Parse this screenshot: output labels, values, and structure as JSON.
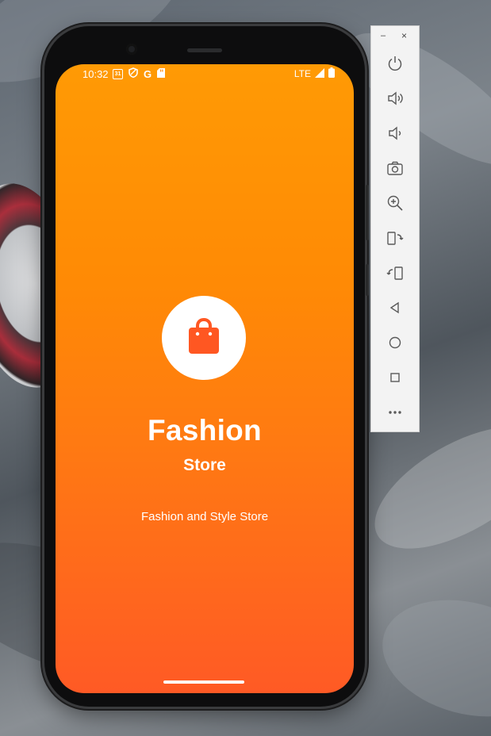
{
  "status_bar": {
    "time": "10:32",
    "calendar_day": "31",
    "g_label": "G",
    "network": "LTE"
  },
  "app": {
    "title": "Fashion",
    "subtitle": "Store",
    "tagline": "Fashion and Style Store",
    "logo_icon": "shopping-bag-icon",
    "accent_color": "#ff5722",
    "gradient_top": "#ff9a05",
    "gradient_bottom": "#ff5a25"
  },
  "emulator_toolbar": {
    "minimize": "–",
    "close": "×",
    "buttons": [
      "power-icon",
      "volume-up-icon",
      "volume-down-icon",
      "camera-icon",
      "zoom-icon",
      "rotate-left-icon",
      "rotate-right-icon",
      "back-icon",
      "home-icon",
      "overview-icon",
      "more-icon"
    ]
  }
}
